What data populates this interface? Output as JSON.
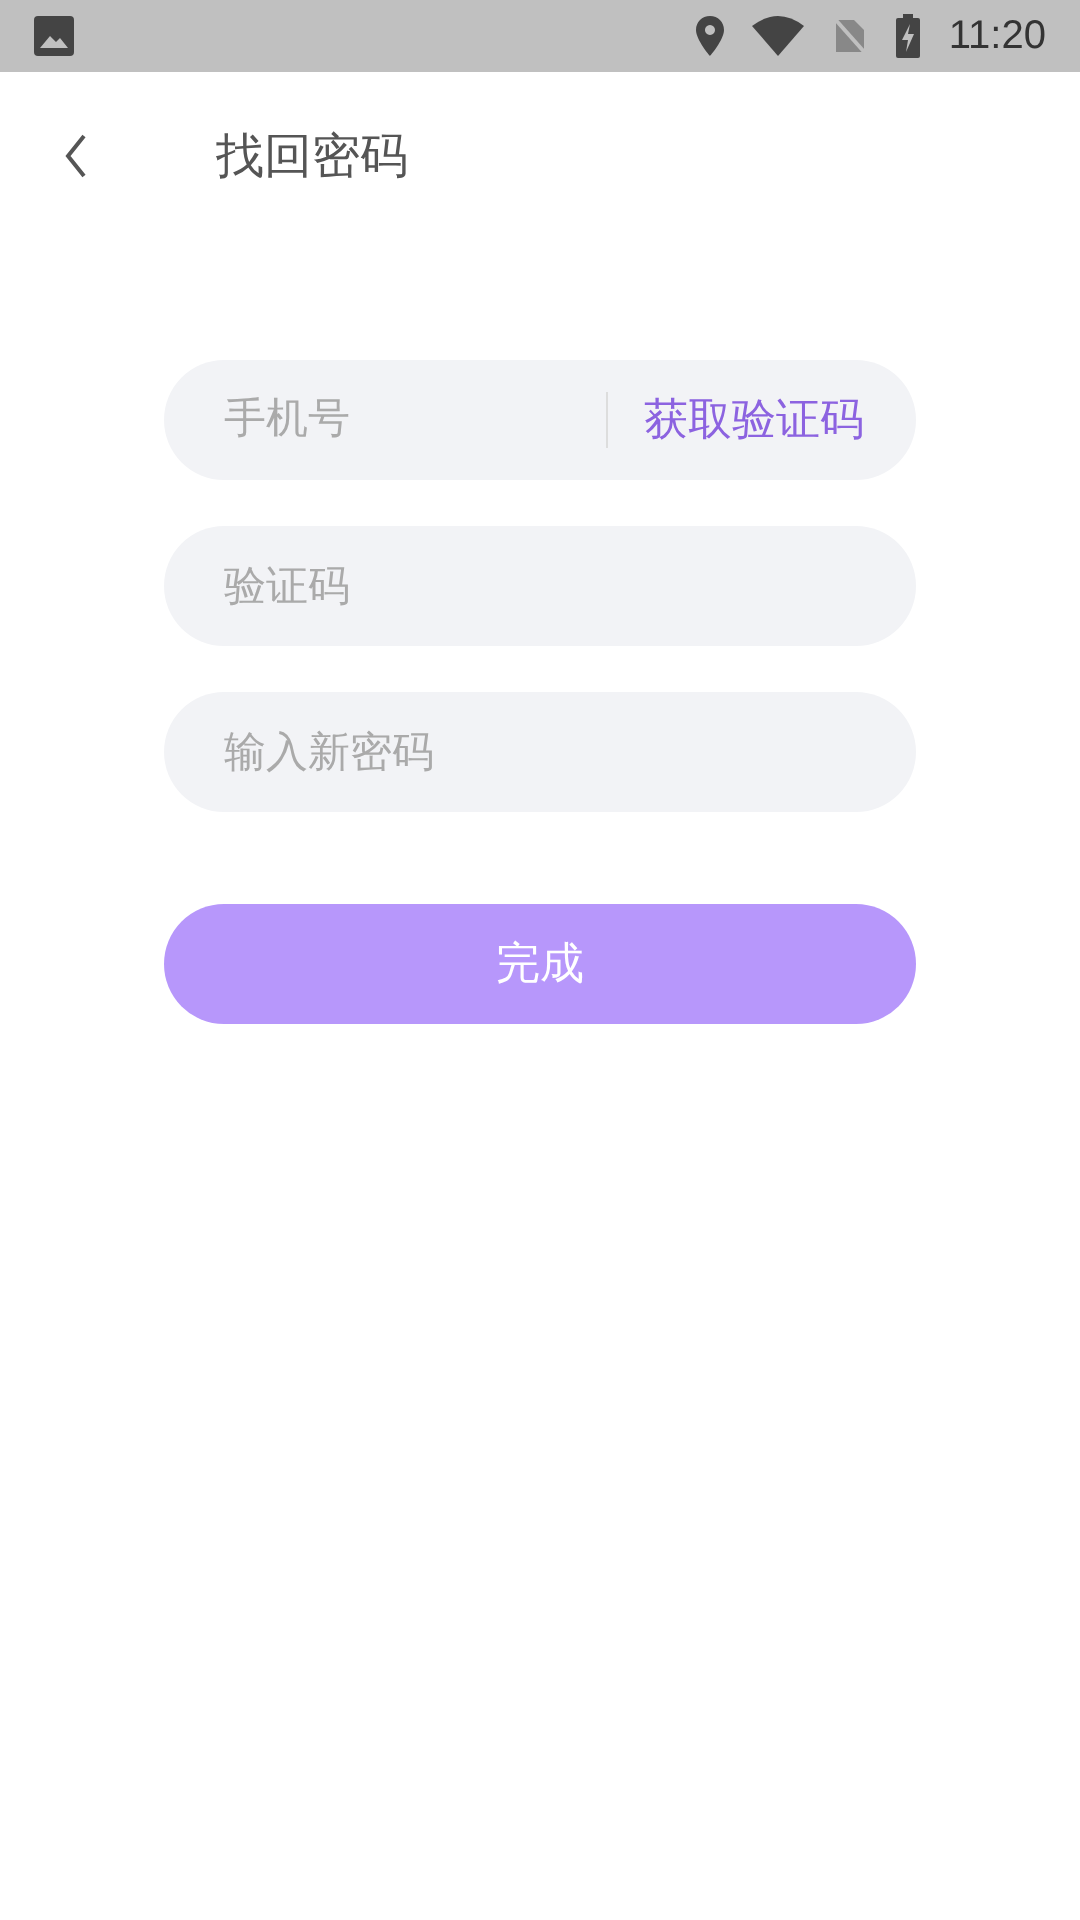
{
  "status_bar": {
    "time": "11:20"
  },
  "header": {
    "title": "找回密码"
  },
  "fields": [
    {
      "kind": "with_action",
      "placeholder": "手机号",
      "action": "获取验证码"
    },
    {
      "kind": "plain",
      "placeholder": "验证码"
    },
    {
      "kind": "plain",
      "placeholder": "输入新密码"
    }
  ],
  "submit": {
    "label": "完成"
  }
}
